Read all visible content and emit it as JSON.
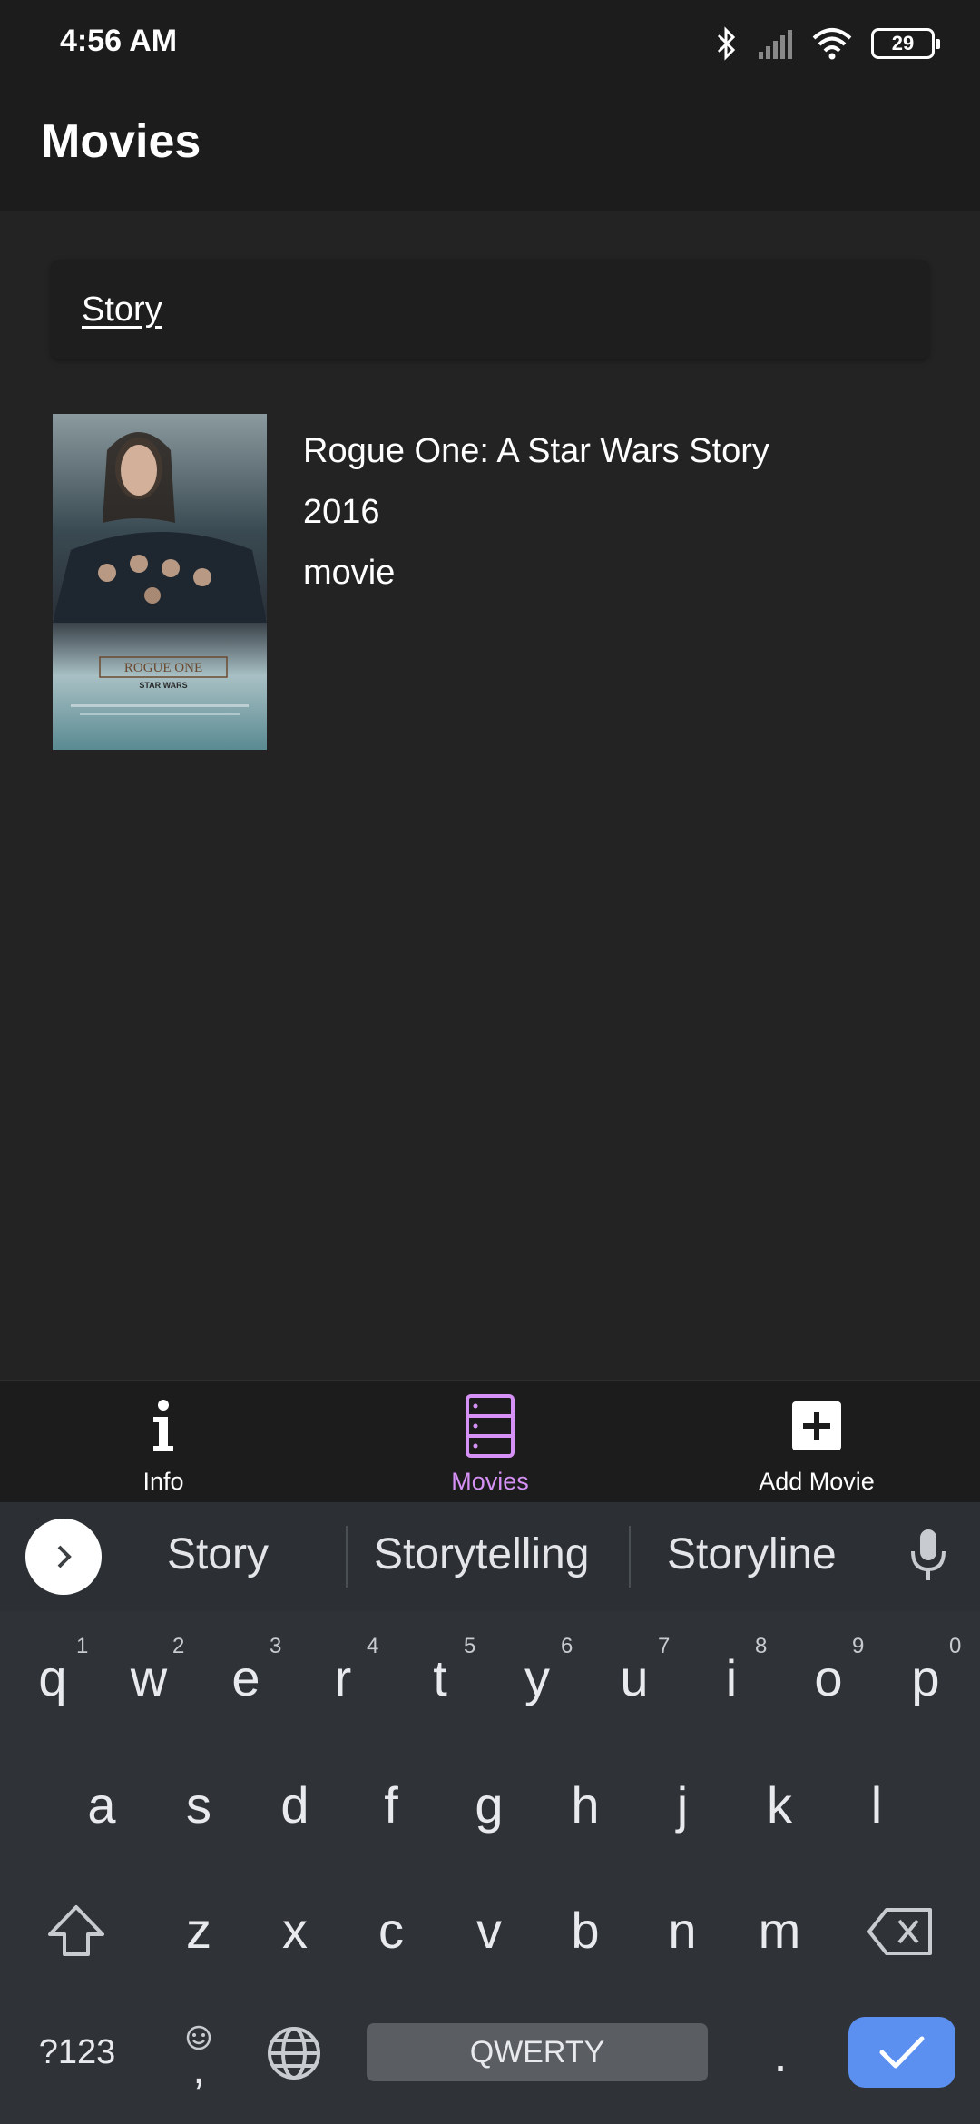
{
  "status_bar": {
    "time": "4:56 AM",
    "battery": "29"
  },
  "app_bar": {
    "title": "Movies"
  },
  "search": {
    "value": "Story"
  },
  "results": [
    {
      "title": "Rogue One: A Star Wars Story",
      "year": "2016",
      "type": "movie",
      "poster_text": "ROGUE ONE",
      "poster_subtext": "STAR WARS"
    }
  ],
  "bottom_nav": {
    "items": [
      {
        "label": "Info",
        "icon": "info-icon",
        "active": false
      },
      {
        "label": "Movies",
        "icon": "server-list-icon",
        "active": true
      },
      {
        "label": "Add Movie",
        "icon": "add-box-icon",
        "active": false
      }
    ]
  },
  "keyboard": {
    "suggestions": [
      "Story",
      "Storytelling",
      "Storyline"
    ],
    "row1": [
      "q",
      "w",
      "e",
      "r",
      "t",
      "y",
      "u",
      "i",
      "o",
      "p"
    ],
    "row1_hints": [
      "1",
      "2",
      "3",
      "4",
      "5",
      "6",
      "7",
      "8",
      "9",
      "0"
    ],
    "row2": [
      "a",
      "s",
      "d",
      "f",
      "g",
      "h",
      "j",
      "k",
      "l"
    ],
    "row3": [
      "z",
      "x",
      "c",
      "v",
      "b",
      "n",
      "m"
    ],
    "symbols_label": "?123",
    "comma": ",",
    "period": ".",
    "space_label": "QWERTY"
  },
  "colors": {
    "accent": "#d591f5",
    "enter": "#5b8ff0",
    "background": "#232323",
    "bar": "#1c1c1c"
  }
}
